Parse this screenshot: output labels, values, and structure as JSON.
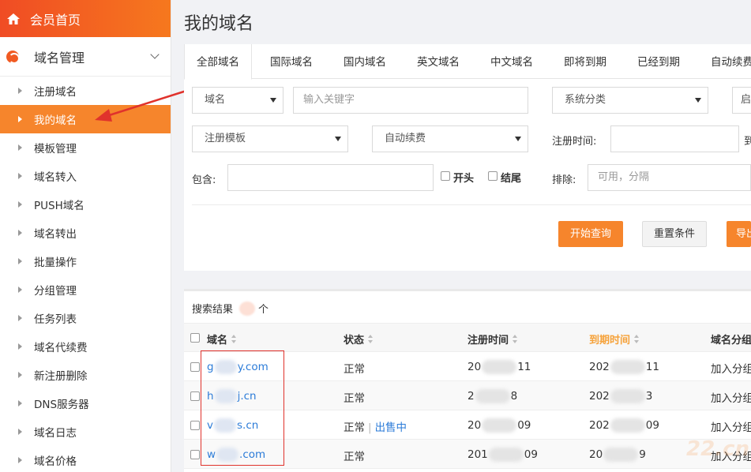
{
  "sidebar": {
    "home_label": "会员首页",
    "group_label": "域名管理",
    "items": [
      {
        "label": "注册域名"
      },
      {
        "label": "我的域名",
        "active": true
      },
      {
        "label": "模板管理"
      },
      {
        "label": "域名转入"
      },
      {
        "label": "PUSH域名"
      },
      {
        "label": "域名转出"
      },
      {
        "label": "批量操作"
      },
      {
        "label": "分组管理"
      },
      {
        "label": "任务列表"
      },
      {
        "label": "域名代续费"
      },
      {
        "label": "新注册删除"
      },
      {
        "label": "DNS服务器"
      },
      {
        "label": "域名日志"
      },
      {
        "label": "域名价格"
      }
    ]
  },
  "page": {
    "title": "我的域名"
  },
  "tabs": [
    "全部域名",
    "国际域名",
    "国内域名",
    "英文域名",
    "中文域名",
    "即将到期",
    "已经到期",
    "自动续费"
  ],
  "filters": {
    "type_select": "域名",
    "keyword_placeholder": "输入关键字",
    "category_select": "系统分类",
    "template_select": "注册模板",
    "renew_select": "自动续费",
    "reg_time_label": "注册时间:",
    "reg_time_to": "到",
    "contains_label": "包含:",
    "starts_label": "开头",
    "ends_label": "结尾",
    "exclude_label": "排除:",
    "exclude_placeholder": "可用，分隔",
    "query_button": "开始查询",
    "reset_button": "重置条件",
    "export_button": "导出",
    "extra_select": "启"
  },
  "results": {
    "summary_prefix": "搜索结果",
    "summary_suffix": "个",
    "columns": [
      "域名",
      "状态",
      "注册时间",
      "到期时间",
      "域名分组"
    ],
    "rows": [
      {
        "domain_start": "g",
        "domain_end": "y.com",
        "status": "正常",
        "sale": "",
        "reg_start": "20",
        "reg_end": "11",
        "exp_start": "202",
        "exp_end": "11",
        "group": "加入分组"
      },
      {
        "domain_start": "h",
        "domain_end": "j.cn",
        "status": "正常",
        "sale": "",
        "reg_start": "2",
        "reg_end": "8",
        "exp_start": "202",
        "exp_end": "3",
        "group": "加入分组"
      },
      {
        "domain_start": "v",
        "domain_end": "s.cn",
        "status": "正常",
        "sale": "出售中",
        "reg_start": "20",
        "reg_end": "09",
        "exp_start": "202",
        "exp_end": "09",
        "group": "加入分组"
      },
      {
        "domain_start": "w",
        "domain_end": ".com",
        "status": "正常",
        "sale": "",
        "reg_start": "201",
        "reg_end": "09",
        "exp_start": "20",
        "exp_end": "9",
        "group": "加入分组"
      }
    ]
  },
  "watermark": "22.cn",
  "colors": {
    "accent": "#f6852c",
    "brand_gradient_start": "#f04c24",
    "link": "#2b7bd8",
    "annotation": "#e0322c"
  }
}
